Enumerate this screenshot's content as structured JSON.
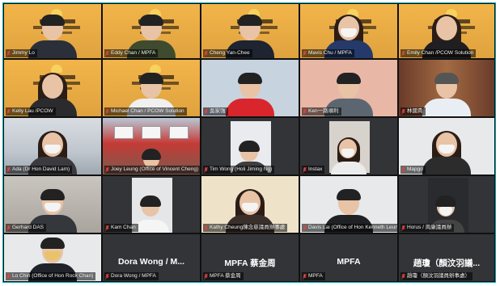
{
  "participants": [
    {
      "name": "Jimmy Lo"
    },
    {
      "name": "Eddy Chan / MPFA"
    },
    {
      "name": "Cheng Yan-Chee"
    },
    {
      "name": "Mavis Chu / MPFA"
    },
    {
      "name": "Emily Chan /PCOW Solution"
    },
    {
      "name": "Kelly Lau /PCOW"
    },
    {
      "name": "Michael Chan / PCOW Solution"
    },
    {
      "name": "吳家強"
    },
    {
      "name": "Ken一路順利"
    },
    {
      "name": "林國貴"
    },
    {
      "name": "Ada (Dr Hon David Lam)"
    },
    {
      "name": "Joey Leung (Office of Vincent Cheng)"
    },
    {
      "name": "Tim Wong (Holi Jiming Ng)"
    },
    {
      "name": "Instax"
    },
    {
      "name": "Mapgo"
    },
    {
      "name": "Gerhard DAS"
    },
    {
      "name": "Kam Chan"
    },
    {
      "name": "Kathy Cheung陳念慈議員辦事處"
    },
    {
      "name": "Davis Lai (Office of Hon Kenneth Leung)"
    },
    {
      "name": "Horus / 周康議員辦"
    },
    {
      "name": "Lo Chin (Office of Hon Rock Chan)"
    },
    {
      "name": "Dora Wong / MPFA",
      "display": "Dora Wong / M..."
    },
    {
      "name": "MPFA 蔡金周",
      "display": "MPFA 蔡金周"
    },
    {
      "name": "MPFA",
      "display": "MPFA"
    },
    {
      "name": "趙瓊（顏汶羽議員辦事處）",
      "display": "趙瓊（顏汶羽議..."
    }
  ],
  "icons": {
    "mic": "microphone-muted-icon"
  },
  "colors": {
    "border": "#00a7b5",
    "tile_text": "#ffffff",
    "muted_mic": "#e0443d"
  }
}
